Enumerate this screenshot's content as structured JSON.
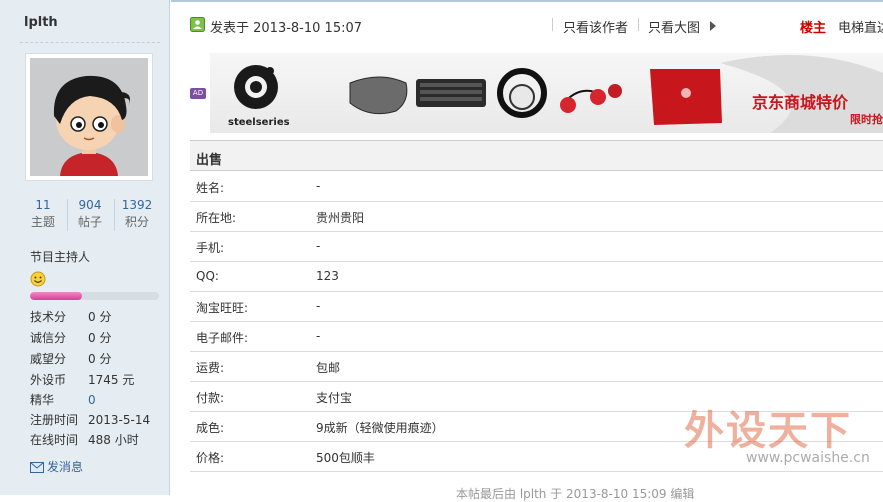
{
  "profile": {
    "username": "lplth",
    "stats": [
      {
        "value": "11",
        "label": "主题"
      },
      {
        "value": "904",
        "label": "帖子"
      },
      {
        "value": "1392",
        "label": "积分"
      }
    ],
    "role": "节目主持人",
    "level_progress": 0.4,
    "info": [
      {
        "key": "技术分",
        "value": "0 分"
      },
      {
        "key": "诚信分",
        "value": "0 分"
      },
      {
        "key": "威望分",
        "value": "0 分"
      },
      {
        "key": "外设币",
        "value": "1745 元"
      },
      {
        "key": "精华",
        "value": "0"
      },
      {
        "key": "注册时间",
        "value": "2013-5-14"
      },
      {
        "key": "在线时间",
        "value": "488 小时"
      }
    ],
    "send_message": "发消息",
    "icons": {
      "smiley": "smiley-icon",
      "message": "envelope-icon"
    }
  },
  "post_header": {
    "posted_at": "发表于 2013-8-10 15:07",
    "author_only": "只看该作者",
    "big_image": "只看大图",
    "floor": "楼主",
    "lift": "电梯直达",
    "icons": {
      "post": "post-icon",
      "arrow": "triangle-right-icon"
    }
  },
  "ad": {
    "badge": "AD",
    "brand": "steelseries",
    "promo": "京东商城特价",
    "promo_sub": "限时抢购"
  },
  "sale_table": {
    "title": "出售",
    "rows": [
      {
        "key": "姓名:",
        "value": "-"
      },
      {
        "key": "所在地:",
        "value": "贵州贵阳"
      },
      {
        "key": "手机:",
        "value": "-"
      },
      {
        "key": "QQ:",
        "value": "123"
      },
      {
        "key": "淘宝旺旺:",
        "value": "-"
      },
      {
        "key": "电子邮件:",
        "value": "-"
      },
      {
        "key": "运费:",
        "value": "包邮"
      },
      {
        "key": "付款:",
        "value": "支付宝"
      },
      {
        "key": "成色:",
        "value": "9成新（轻微使用痕迹）"
      },
      {
        "key": "价格:",
        "value": "500包顺丰"
      }
    ]
  },
  "edit_note": "本帖最后由 lplth 于 2013-8-10 15:09 编辑",
  "watermark": {
    "title": "外设天下",
    "url": "www.pcwaishe.cn"
  },
  "colors": {
    "sidebar_bg": "#e5edf2",
    "link": "#336699",
    "floor": "#cc0000",
    "progress": "#d93e94"
  }
}
